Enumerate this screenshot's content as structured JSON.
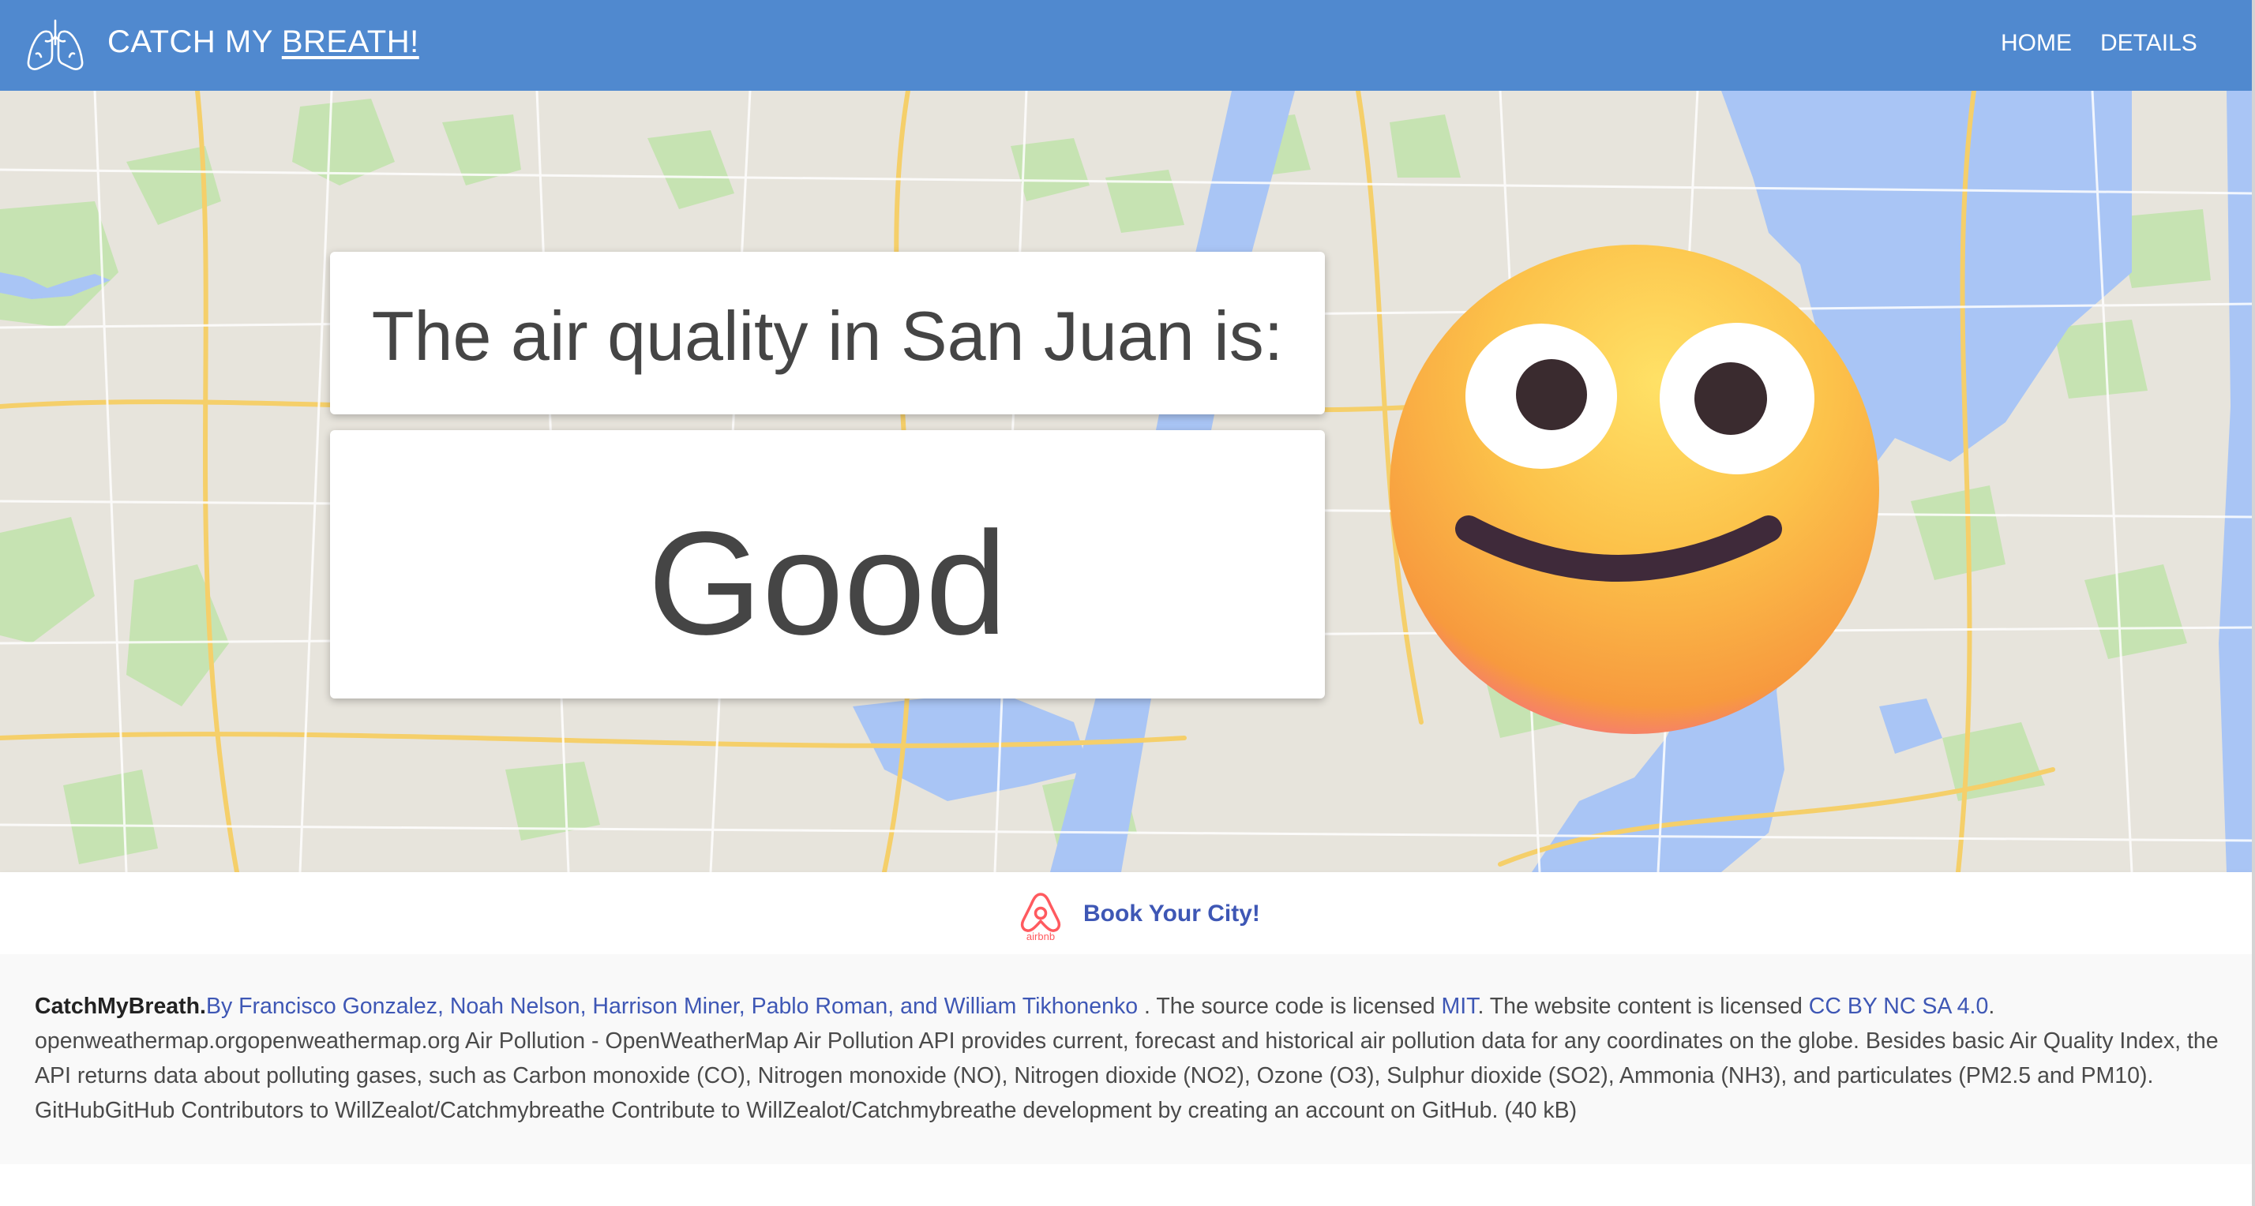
{
  "navbar": {
    "brand_prefix": "CATCH MY",
    "brand_underlined": "BREATH!",
    "links": [
      {
        "label": "HOME"
      },
      {
        "label": "DETAILS"
      }
    ],
    "color": "#5089cf"
  },
  "hero": {
    "title": "The air quality in San Juan is:",
    "quality": "Good",
    "emoji": "smiling-face-3d-icon"
  },
  "booking": {
    "logo_text": "airbnb",
    "link": "Book Your City!"
  },
  "footer": {
    "site_name": "CatchMyBreath.",
    "authors_link": "By Francisco Gonzalez, Noah Nelson, Harrison Miner, Pablo Roman, and William Tikhonenko",
    "text_source": " . The source code is licensed ",
    "license_code": "MIT",
    "text_content": ". The website content is licensed ",
    "license_content": "CC BY NC SA 4.0",
    "text_end": ".",
    "description": "openweathermap.orgopenweathermap.org Air Pollution - OpenWeatherMap Air Pollution API provides current, forecast and historical air pollution data for any coordinates on the globe. Besides basic Air Quality Index, the API returns data about polluting gases, such as Carbon monoxide (CO), Nitrogen monoxide (NO), Nitrogen dioxide (NO2), Ozone (O3), Sulphur dioxide (SO2), Ammonia (NH3), and particulates (PM2.5 and PM10). GitHubGitHub Contributors to WillZealot/Catchmybreathe Contribute to WillZealot/Catchmybreathe development by creating an account on GitHub. (40 kB)"
  },
  "colors": {
    "accent": "#5089cf",
    "link": "#3e57b5",
    "water": "#a9c5f5",
    "park": "#c4e2b0",
    "airbnb": "#ff5a5f"
  }
}
